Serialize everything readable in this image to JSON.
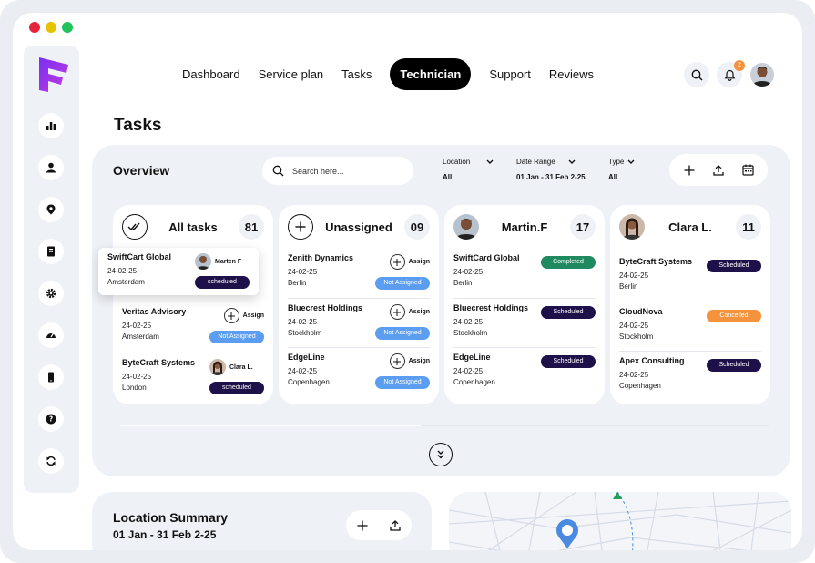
{
  "window_controls": {
    "close_color": "#e5243b",
    "minimize_color": "#e6c200",
    "maximize_color": "#22c25a"
  },
  "nav": {
    "items": [
      "Dashboard",
      "Service plan",
      "Tasks",
      "Technician",
      "Support",
      "Reviews"
    ],
    "active": "Technician"
  },
  "notifications": {
    "count": "2"
  },
  "page_title": "Tasks",
  "overview": {
    "title": "Overview",
    "search_placeholder": "Search here...",
    "filters": [
      {
        "label": "Location",
        "value": "All"
      },
      {
        "label": "Date Range",
        "value": "01 Jan - 31 Feb 2-25"
      },
      {
        "label": "Type",
        "value": "All"
      }
    ],
    "columns": [
      {
        "name": "All tasks",
        "count": "81",
        "floating_task": {
          "company": "SwiftCart Global",
          "date": "24-02-25",
          "location": "Amsterdam",
          "technician": "Marten F",
          "status": "scheduled"
        },
        "tasks": [
          {
            "company": "Veritas Advisory",
            "date": "24-02-25",
            "location": "Amsterdam",
            "action": "Assign",
            "status": "Not Assigned"
          },
          {
            "company": "ByteCraft Systems",
            "date": "24-02-25",
            "location": "London",
            "technician": "Clara L.",
            "status": "scheduled"
          }
        ]
      },
      {
        "name": "Unassigned",
        "count": "09",
        "tasks": [
          {
            "company": "Zenith Dynamics",
            "date": "24-02-25",
            "location": "Berlin",
            "action": "Assign",
            "status": "Not Assigned"
          },
          {
            "company": "Bluecrest Holdings",
            "date": "24-02-25",
            "location": "Stockholm",
            "action": "Assign",
            "status": "Not Assigned"
          },
          {
            "company": "EdgeLine",
            "date": "24-02-25",
            "location": "Copenhagen",
            "action": "Assign",
            "status": "Not Assigned"
          }
        ]
      },
      {
        "name": "Martin.F",
        "count": "17",
        "tasks": [
          {
            "company": "SwiftCard Global",
            "date": "24-02-25",
            "location": "Berlin",
            "status": "Completed"
          },
          {
            "company": "Bluecrest Holdings",
            "date": "24-02-25",
            "location": "Stockholm",
            "status": "Scheduled"
          },
          {
            "company": "EdgeLine",
            "date": "24-02-25",
            "location": "Copenhagen",
            "status": "Scheduled"
          }
        ]
      },
      {
        "name": "Clara L.",
        "count": "11",
        "tasks": [
          {
            "company": "ByteCraft Systems",
            "date": "24-02-25",
            "location": "Berlin",
            "status": "Scheduled"
          },
          {
            "company": "CloudNova",
            "date": "24-02-25",
            "location": "Stockholm",
            "status": "Cancelled"
          },
          {
            "company": "Apex Consulting",
            "date": "24-02-25",
            "location": "Copenhagen",
            "status": "Scheduled"
          }
        ]
      }
    ]
  },
  "location_summary": {
    "title": "Location Summary",
    "range": "01 Jan - 31 Feb 2-25"
  },
  "colors": {
    "scheduled": "#1e1048",
    "not_assigned": "#5b9df1",
    "completed": "#1f8a60",
    "cancelled": "#f5923e",
    "brand": "#6d2bd9"
  }
}
